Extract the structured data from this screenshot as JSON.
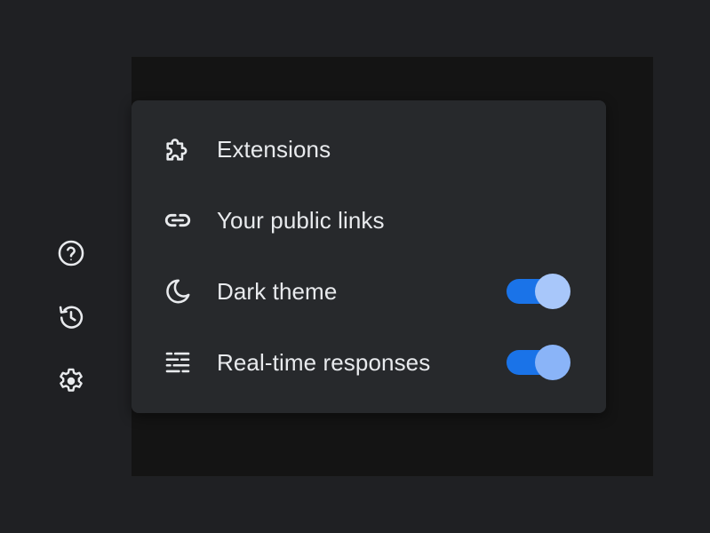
{
  "sidebar": {
    "icons": [
      {
        "name": "help-icon"
      },
      {
        "name": "history-icon"
      },
      {
        "name": "settings-gear-icon"
      }
    ]
  },
  "menu": {
    "items": [
      {
        "label": "Extensions",
        "icon": "puzzle-icon"
      },
      {
        "label": "Your public links",
        "icon": "link-icon"
      },
      {
        "label": "Dark theme",
        "icon": "moon-icon",
        "toggle": true,
        "toggle_on": true
      },
      {
        "label": "Real-time responses",
        "icon": "stream-lines-icon",
        "toggle": true,
        "toggle_on": true
      }
    ]
  },
  "colors": {
    "background": "#1f2023",
    "menu_background": "#27292c",
    "text": "#e8eaed",
    "toggle_track": "#1a73e8",
    "toggle_knob_dark_theme": "#a8c7fa",
    "toggle_knob_realtime": "#8ab4f8"
  }
}
